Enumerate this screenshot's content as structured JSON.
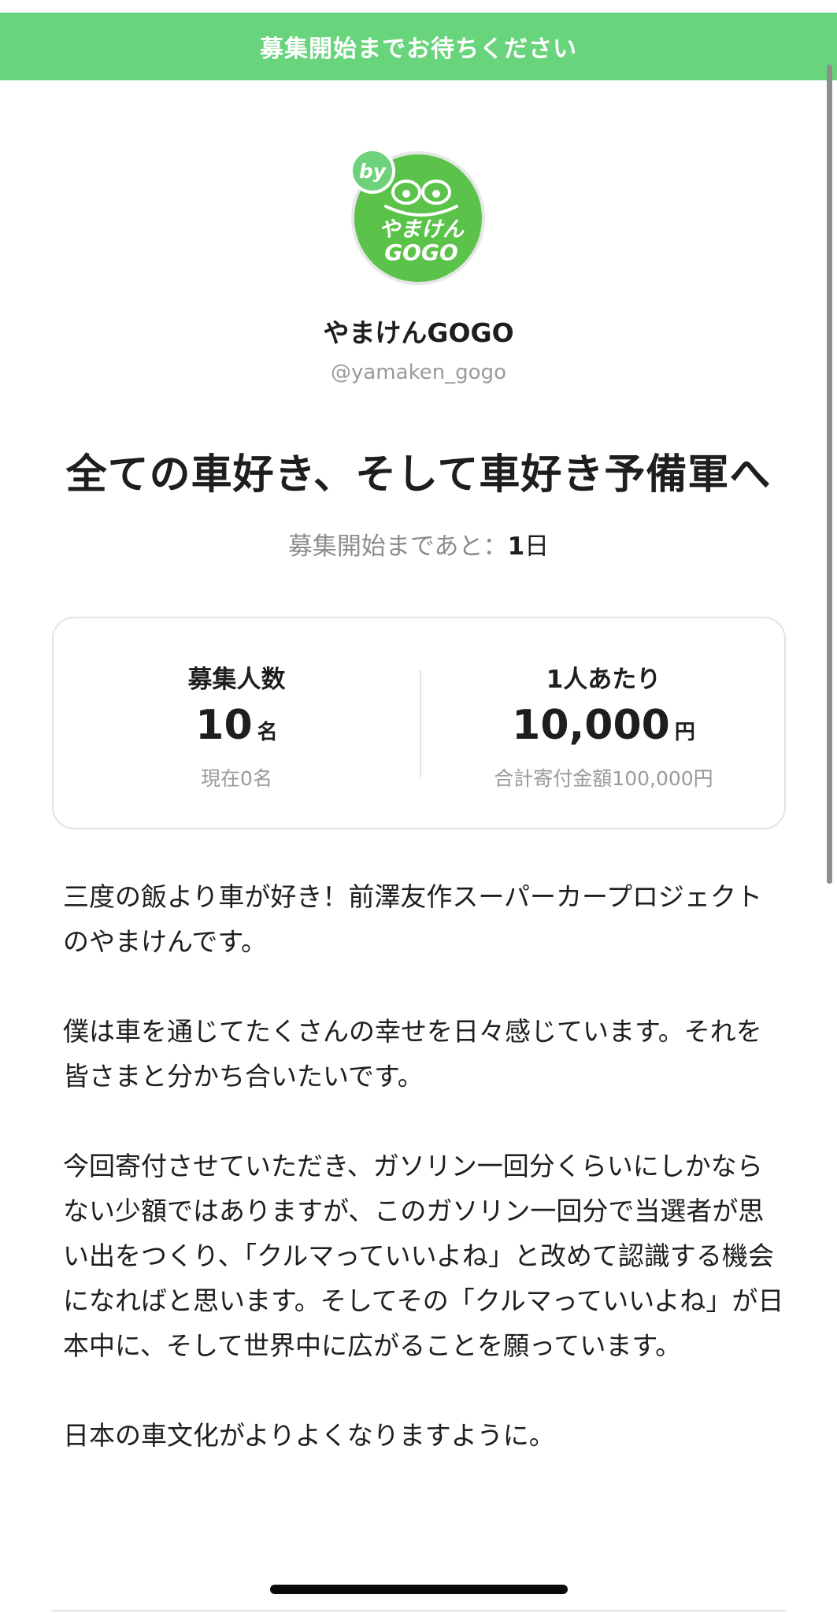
{
  "banner": {
    "text": "募集開始までお待ちください"
  },
  "account": {
    "avatar_icon": "frog-logo-icon",
    "badge_label": "by",
    "logo_text_line1": "やまけん",
    "logo_text_line2": "GOGO",
    "name": "やまけんGOGO",
    "handle": "@yamaken_gogo"
  },
  "campaign": {
    "title": "全ての車好き、そして車好き予備軍へ",
    "countdown_prefix": "募集開始まであと：",
    "countdown_value": "1",
    "countdown_unit": "日"
  },
  "stats": {
    "recruit": {
      "label": "募集人数",
      "value": "10",
      "unit": "名",
      "sub": "現在0名"
    },
    "per_person": {
      "label": "1人あたり",
      "value": "10,000",
      "unit": "円",
      "sub": "合計寄付金額100,000円"
    }
  },
  "description": {
    "paragraphs": [
      "三度の飯より車が好き！前澤友作スーパーカープロジェクトのやまけんです。",
      "僕は車を通じてたくさんの幸せを日々感じています。それを皆さまと分かち合いたいです。",
      "今回寄付させていただき、ガソリン一回分くらいにしかならない少額ではありますが、このガソリン一回分で当選者が思い出をつくり、「クルマっていいよね」と改めて認識する機会になればと思います。そしてその「クルマっていいよね」が日本中に、そして世界中に広がることを願っています。",
      "日本の車文化がよりよくなりますように。"
    ]
  },
  "colors": {
    "banner": "#68d47c",
    "logo": "#5bc24a",
    "text": "#1e1e1e",
    "muted": "#9a9a9a"
  }
}
